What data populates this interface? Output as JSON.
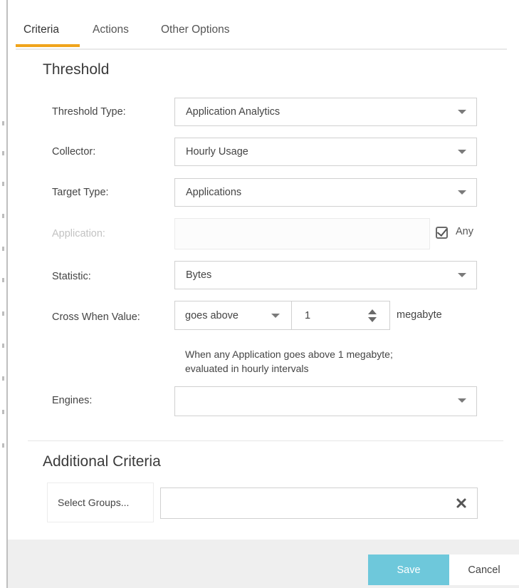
{
  "tabs": [
    {
      "label": "Criteria",
      "active": true
    },
    {
      "label": "Actions",
      "active": false
    },
    {
      "label": "Other Options",
      "active": false
    }
  ],
  "threshold": {
    "title": "Threshold",
    "threshold_type": {
      "label": "Threshold Type:",
      "value": "Application Analytics"
    },
    "collector": {
      "label": "Collector:",
      "value": "Hourly Usage"
    },
    "target_type": {
      "label": "Target Type:",
      "value": "Applications"
    },
    "application": {
      "label": "Application:",
      "value": "",
      "any_label": "Any",
      "any_checked": true
    },
    "statistic": {
      "label": "Statistic:",
      "value": "Bytes"
    },
    "cross_when": {
      "label": "Cross When Value:",
      "condition": "goes above",
      "amount": "1",
      "unit": "megabyte",
      "hint_line1": "When any Application goes above 1 megabyte;",
      "hint_line2": "evaluated in hourly intervals"
    },
    "engines": {
      "label": "Engines:",
      "value": ""
    }
  },
  "additional": {
    "title": "Additional Criteria",
    "select_groups_label": "Select Groups...",
    "groups_value": ""
  },
  "footer": {
    "save_label": "Save",
    "cancel_label": "Cancel"
  },
  "colors": {
    "accent_tab": "#f0a41c",
    "save_button": "#6ec8db",
    "footer_bg": "#efefef"
  },
  "icons": {
    "dropdown": "caret-down-icon",
    "spinner": "spinner-arrows-icon",
    "clear": "close-x-icon",
    "checkbox": "checkbox-checked-icon"
  }
}
